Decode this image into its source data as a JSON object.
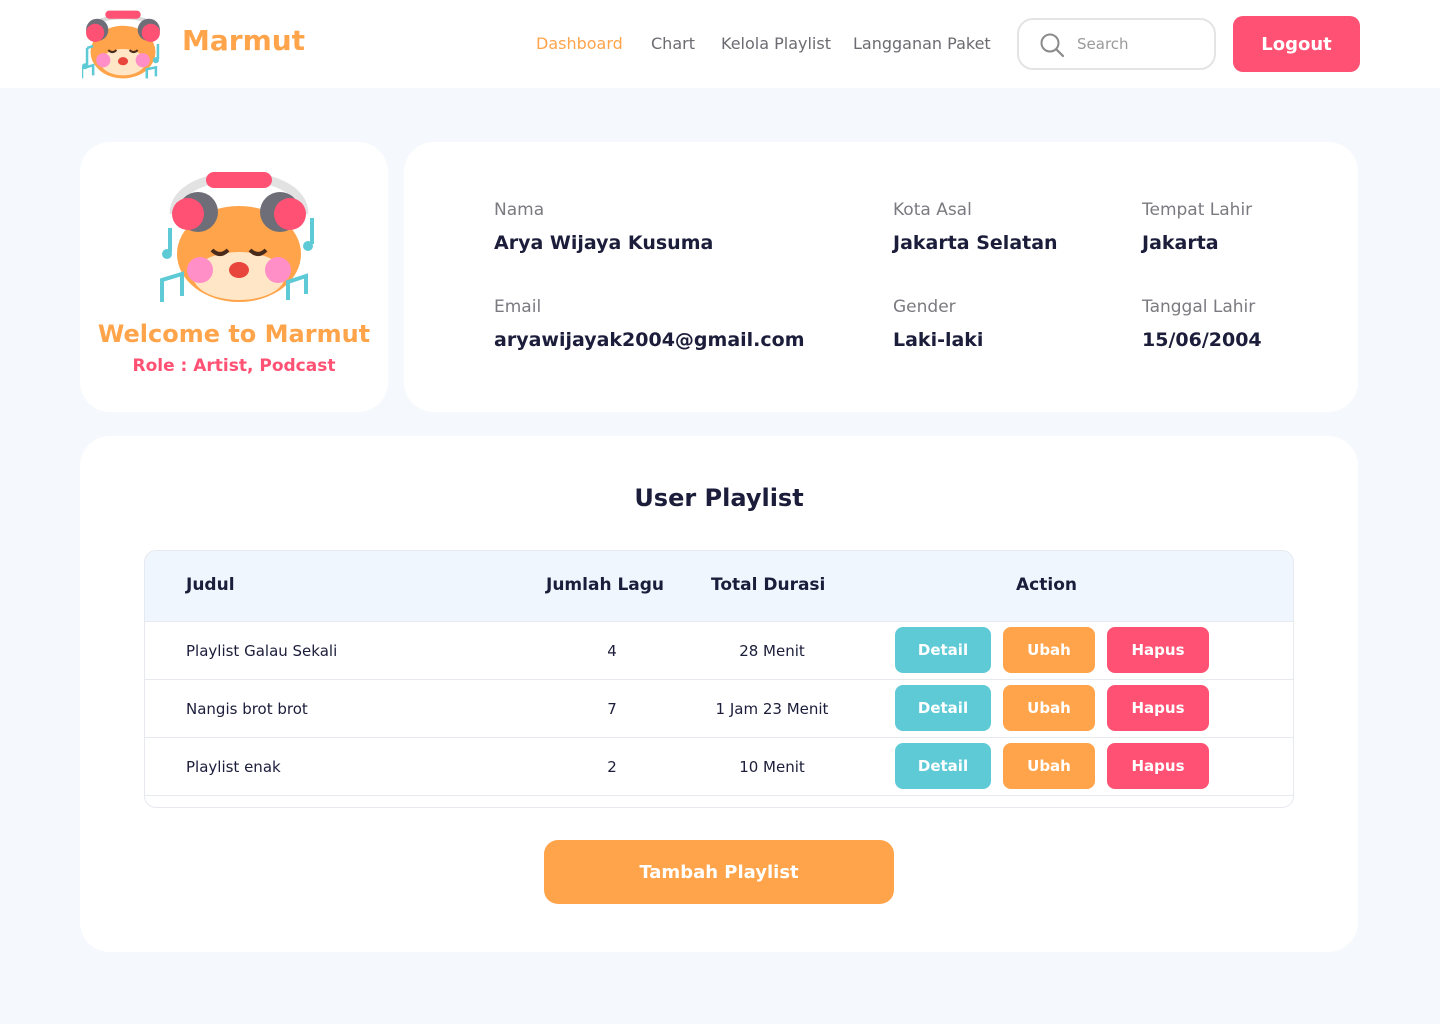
{
  "header": {
    "brand": "Marmut",
    "nav": [
      "Dashboard",
      "Chart",
      "Kelola Playlist",
      "Langganan Paket"
    ],
    "active_nav": "Dashboard",
    "search_placeholder": "Search",
    "logout_label": "Logout"
  },
  "profile": {
    "welcome": "Welcome to Marmut",
    "role": "Role : Artist, Podcast"
  },
  "info": {
    "nama_label": "Nama",
    "nama": "Arya Wijaya Kusuma",
    "kota_label": "Kota Asal",
    "kota": "Jakarta Selatan",
    "tempat_lahir_label": "Tempat Lahir",
    "tempat_lahir": "Jakarta",
    "email_label": "Email",
    "email": "aryawijayak2004@gmail.com",
    "gender_label": "Gender",
    "gender": "Laki-laki",
    "tanggal_lahir_label": "Tanggal Lahir",
    "tanggal_lahir": "15/06/2004"
  },
  "playlist": {
    "title": "User Playlist",
    "columns": [
      "Judul",
      "Jumlah Lagu",
      "Total Durasi",
      "Action"
    ],
    "rows": [
      {
        "judul": "Playlist Galau Sekali",
        "jumlah": "4",
        "durasi": "28 Menit"
      },
      {
        "judul": "Nangis brot brot",
        "jumlah": "7",
        "durasi": "1 Jam 23 Menit"
      },
      {
        "judul": "Playlist enak",
        "jumlah": "2",
        "durasi": "10 Menit"
      }
    ],
    "actions": {
      "detail": "Detail",
      "ubah": "Ubah",
      "hapus": "Hapus"
    },
    "add_label": "Tambah Playlist"
  },
  "colors": {
    "accent": "#FFA44A",
    "danger": "#FF5173",
    "info": "#5ECAD6",
    "text": "#1B1D3A",
    "background": "#F5F9FD"
  }
}
